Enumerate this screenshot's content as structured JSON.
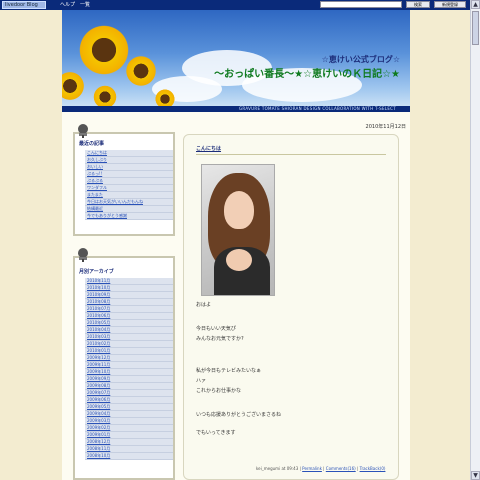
{
  "topbar": {
    "logo": "livedoor Blog",
    "links": "ヘルプ　一覧",
    "search_value": "",
    "btn1": "検索",
    "btn2": "新規登録"
  },
  "header": {
    "title1": "☆恵けい公式ブログ☆",
    "title2": "～おっぱい番長～★☆恵けいのＫ日記☆★",
    "credit": "GRAVURE TOMATE SHIORAN   DESIGN COLLABORATION WITH T-SELECT"
  },
  "sidebar": {
    "recent": {
      "title": "最近の記事",
      "items": [
        "こんにちは",
        "お久しぶり",
        "おいしい",
        "ぷるっ!!",
        "ぷるぷる",
        "ワンダフル",
        "またまた",
        "今日はお天気がいいんだもんね",
        "結構最近",
        "今でもありがとう感謝"
      ]
    },
    "archive": {
      "title": "月別アーカイブ",
      "items": [
        "2010年11月",
        "2010年10月",
        "2010年09月",
        "2010年08月",
        "2010年07月",
        "2010年06月",
        "2010年05月",
        "2010年04月",
        "2010年03月",
        "2010年02月",
        "2010年01月",
        "2009年12月",
        "2009年11月",
        "2009年10月",
        "2009年09月",
        "2009年08月",
        "2009年07月",
        "2009年06月",
        "2009年05月",
        "2009年04月",
        "2009年03月",
        "2009年02月",
        "2009年01月",
        "2008年12月",
        "2008年11月",
        "2008年10月"
      ]
    }
  },
  "entry": {
    "date": "2010年11月12日",
    "title": "こんにちは",
    "lines": [
      "おはよ",
      "",
      "今日もいい天気ぴ",
      "みんなお元気ですか?",
      "",
      "",
      "私が今日もテレビみたいなぁ",
      "ハァ",
      "これからお仕事かな",
      "",
      "いつも応援ありがとうございまさるね",
      "",
      "でもいってきます"
    ],
    "footer_author": "kei_megumi at 09:43",
    "footer_permalink": "Permalink",
    "footer_comments": "Comments(16)",
    "footer_trackback": "TrackBack(0)"
  },
  "colors": {
    "navy": "#0a2a7a",
    "page_bg": "#f3ecd0",
    "link": "#2a52b8",
    "title_green": "#0e7a1e"
  }
}
